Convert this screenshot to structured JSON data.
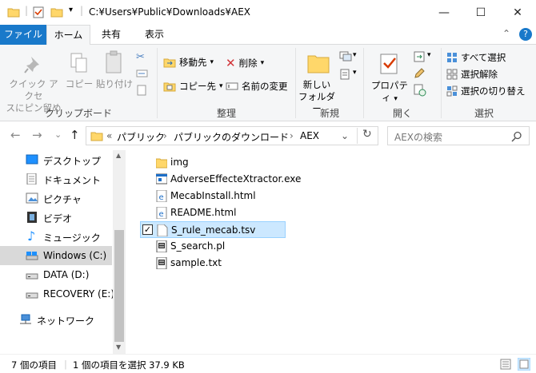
{
  "titlebar": {
    "path": "C:¥Users¥Public¥Downloads¥AEX",
    "minimize": "—",
    "maximize": "☐",
    "close": "✕"
  },
  "tabs": {
    "file": "ファイル",
    "home": "ホーム",
    "share": "共有",
    "view": "表示",
    "collapse": "⌃",
    "help": "?"
  },
  "ribbon": {
    "clipboard": {
      "pin": "クイック アクセ\nスにピン留め",
      "pin_line1": "クイック アクセ",
      "pin_line2": "スにピン留め",
      "copy": "コピー",
      "paste": "貼り付け",
      "label": "クリップボード"
    },
    "organize": {
      "move_to": "移動先",
      "copy_to": "コピー先",
      "delete": "削除",
      "rename": "名前の変更",
      "label": "整理"
    },
    "new": {
      "new_folder_line1": "新しい",
      "new_folder_line2": "フォルダー",
      "label": "新規"
    },
    "open": {
      "properties": "プロパティ",
      "label": "開く"
    },
    "select": {
      "select_all": "すべて選択",
      "select_none": "選択解除",
      "invert": "選択の切り替え",
      "label": "選択"
    }
  },
  "address": {
    "back": "←",
    "forward": "→",
    "recent": "⌄",
    "up": "↑",
    "overflow": "«",
    "crumbs": [
      "パブリック",
      "パブリックのダウンロード",
      "AEX"
    ],
    "separator": "›",
    "refresh": "↻",
    "search_placeholder": "AEXの検索"
  },
  "nav": {
    "items": [
      {
        "label": "デスクトップ"
      },
      {
        "label": "ドキュメント"
      },
      {
        "label": "ピクチャ"
      },
      {
        "label": "ビデオ"
      },
      {
        "label": "ミュージック"
      },
      {
        "label": "Windows (C:)"
      },
      {
        "label": "DATA (D:)"
      },
      {
        "label": "RECOVERY (E:)"
      },
      {
        "label": "ネットワーク"
      }
    ]
  },
  "files": [
    {
      "name": "img",
      "type": "folder"
    },
    {
      "name": "AdverseEffecteXtractor.exe",
      "type": "exe"
    },
    {
      "name": "MecabInstall.html",
      "type": "html"
    },
    {
      "name": "README.html",
      "type": "html"
    },
    {
      "name": "S_rule_mecab.tsv",
      "type": "doc",
      "selected": true
    },
    {
      "name": "S_search.pl",
      "type": "script"
    },
    {
      "name": "sample.txt",
      "type": "script"
    }
  ],
  "status": {
    "count": "7 個の項目",
    "selection": "1 個の項目を選択  37.9 KB"
  },
  "colors": {
    "accent": "#1979ca",
    "selected_bg": "#cce8ff",
    "folder": "#ffd76a"
  }
}
